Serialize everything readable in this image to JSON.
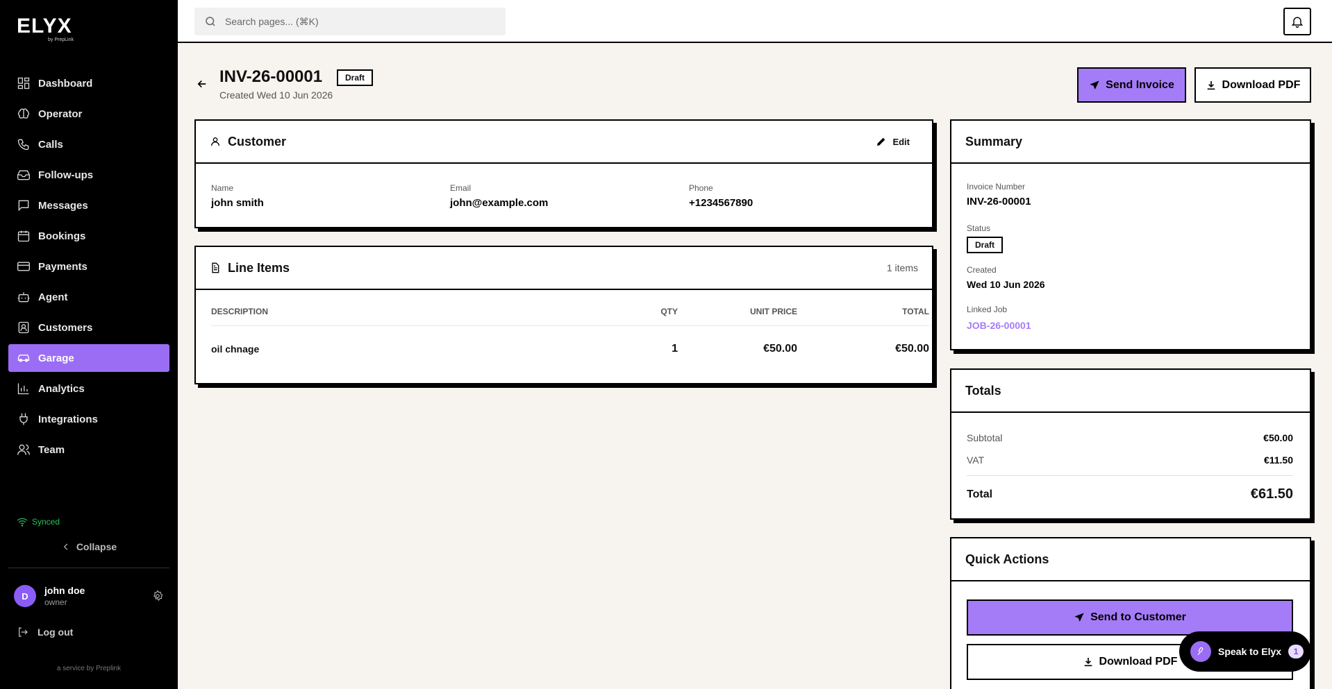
{
  "brand": {
    "logo": "ELYX",
    "logo_sub": "by PrepLink",
    "service": "a service by Preplink"
  },
  "sidebar": {
    "items": [
      {
        "label": "Dashboard",
        "icon": "grid-icon"
      },
      {
        "label": "Operator",
        "icon": "brain-icon"
      },
      {
        "label": "Calls",
        "icon": "phone-icon"
      },
      {
        "label": "Follow-ups",
        "icon": "inbox-icon"
      },
      {
        "label": "Messages",
        "icon": "message-icon"
      },
      {
        "label": "Bookings",
        "icon": "calendar-icon"
      },
      {
        "label": "Payments",
        "icon": "card-icon"
      },
      {
        "label": "Agent",
        "icon": "robot-icon"
      },
      {
        "label": "Customers",
        "icon": "contact-icon"
      },
      {
        "label": "Garage",
        "icon": "car-icon"
      },
      {
        "label": "Analytics",
        "icon": "bar-chart-icon"
      },
      {
        "label": "Integrations",
        "icon": "plug-icon"
      },
      {
        "label": "Team",
        "icon": "users-icon"
      }
    ],
    "active": "Garage",
    "synced": "Synced",
    "collapse": "Collapse",
    "user": {
      "initial": "D",
      "name": "john doe",
      "role": "owner"
    },
    "logout": "Log out"
  },
  "topbar": {
    "search_placeholder": "Search pages... (⌘K)"
  },
  "header": {
    "invoice_number": "INV-26-00001",
    "status": "Draft",
    "created": "Created Wed 10 Jun 2026",
    "send_label": "Send Invoice",
    "download_label": "Download PDF"
  },
  "customer": {
    "title": "Customer",
    "edit": "Edit",
    "name_label": "Name",
    "name": "john smith",
    "email_label": "Email",
    "email": "john@example.com",
    "phone_label": "Phone",
    "phone": "+1234567890"
  },
  "line_items": {
    "title": "Line Items",
    "count": "1 items",
    "headers": {
      "description": "DESCRIPTION",
      "qty": "QTY",
      "unit_price": "UNIT PRICE",
      "total": "TOTAL"
    },
    "rows": [
      {
        "description": "oil chnage",
        "qty": "1",
        "unit_price": "€50.00",
        "total": "€50.00"
      }
    ]
  },
  "summary": {
    "title": "Summary",
    "invoice_number_label": "Invoice Number",
    "invoice_number": "INV-26-00001",
    "status_label": "Status",
    "status": "Draft",
    "created_label": "Created",
    "created": "Wed 10 Jun 2026",
    "linked_job_label": "Linked Job",
    "linked_job": "JOB-26-00001"
  },
  "totals": {
    "title": "Totals",
    "subtotal_label": "Subtotal",
    "subtotal": "€50.00",
    "vat_label": "VAT",
    "vat": "€11.50",
    "total_label": "Total",
    "total": "€61.50"
  },
  "quick_actions": {
    "title": "Quick Actions",
    "send": "Send to Customer",
    "download": "Download PDF"
  },
  "assistant": {
    "label": "Speak to Elyx",
    "count": "1"
  },
  "colors": {
    "accent": "#a57cf7",
    "background": "#f7f3ee",
    "synced": "#22c55e"
  }
}
